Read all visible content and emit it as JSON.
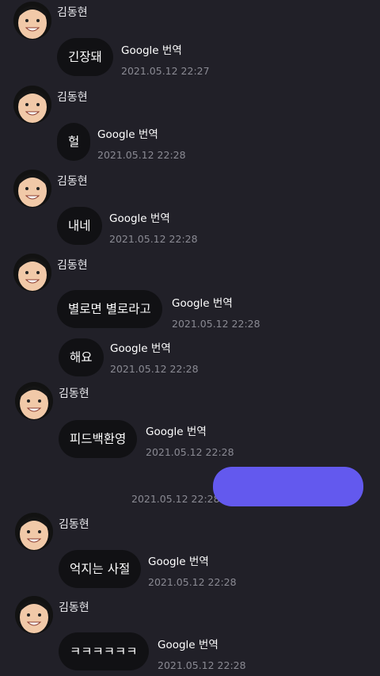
{
  "sender_name": "김동현",
  "translate_label": "Google 번역",
  "colors": {
    "background": "#212028",
    "bubble_other": "#111114",
    "bubble_mine": "#6359ee",
    "timestamp": "#8a8a93"
  },
  "messages": [
    {
      "text": "긴장돼",
      "time": "2021.05.12 22:27"
    },
    {
      "text": "헐",
      "time": "2021.05.12 22:28"
    },
    {
      "text": "내네",
      "time": "2021.05.12 22:28"
    },
    {
      "text": "별로면 별로라고",
      "time": "2021.05.12 22:28"
    },
    {
      "text": "해요",
      "time": "2021.05.12 22:28"
    },
    {
      "text": "피드백환영",
      "time": "2021.05.12 22:28"
    },
    {
      "text": "억지는 사절",
      "time": "2021.05.12 22:28"
    },
    {
      "text": "ㅋㅋㅋㅋㅋㅋ",
      "time": "2021.05.12 22:28"
    }
  ],
  "my_message": {
    "time": "2021.05.12 22:28"
  }
}
